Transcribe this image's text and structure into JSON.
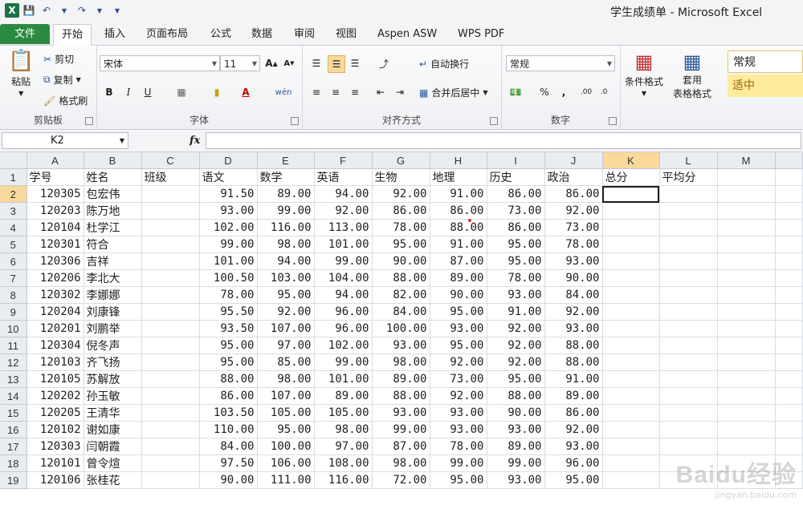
{
  "window": {
    "title": "学生成绩单 - Microsoft Excel",
    "app_icon": "X"
  },
  "quick_access": {
    "save_icon": "save-icon",
    "undo_icon": "undo-icon",
    "redo_icon": "redo-icon"
  },
  "tabs": [
    "文件",
    "开始",
    "插入",
    "页面布局",
    "公式",
    "数据",
    "审阅",
    "视图",
    "Aspen ASW",
    "WPS PDF"
  ],
  "ribbon": {
    "clipboard": {
      "paste": "粘贴",
      "cut": "剪切",
      "copy": "复制",
      "format_painter": "格式刷",
      "label": "剪贴板"
    },
    "font": {
      "name": "宋体",
      "size": "11",
      "label": "字体",
      "bold": "B",
      "italic": "I",
      "underline": "U",
      "wen": "wén"
    },
    "alignment": {
      "wrap": "自动换行",
      "merge": "合并后居中",
      "label": "对齐方式"
    },
    "number": {
      "format": "常规",
      "percent": "%",
      "comma": ",",
      "label": "数字"
    },
    "styles": {
      "conditional": "条件格式",
      "table_format_1": "套用",
      "table_format_2": "表格格式",
      "style_normal": "常规",
      "style_neutral": "适中"
    }
  },
  "formula_bar": {
    "name_box": "K2",
    "fx": "fx",
    "value": ""
  },
  "columns": [
    "A",
    "B",
    "C",
    "D",
    "E",
    "F",
    "G",
    "H",
    "I",
    "J",
    "K",
    "L",
    "M"
  ],
  "header_row": [
    "学号",
    "姓名",
    "班级",
    "语文",
    "数学",
    "英语",
    "生物",
    "地理",
    "历史",
    "政治",
    "总分",
    "平均分",
    ""
  ],
  "rows": [
    [
      "120305",
      "包宏伟",
      "",
      "91.50",
      "89.00",
      "94.00",
      "92.00",
      "91.00",
      "86.00",
      "86.00"
    ],
    [
      "120203",
      "陈万地",
      "",
      "93.00",
      "99.00",
      "92.00",
      "86.00",
      "86.00",
      "73.00",
      "92.00"
    ],
    [
      "120104",
      "杜学江",
      "",
      "102.00",
      "116.00",
      "113.00",
      "78.00",
      "88.00",
      "86.00",
      "73.00"
    ],
    [
      "120301",
      "符合",
      "",
      "99.00",
      "98.00",
      "101.00",
      "95.00",
      "91.00",
      "95.00",
      "78.00"
    ],
    [
      "120306",
      "吉祥",
      "",
      "101.00",
      "94.00",
      "99.00",
      "90.00",
      "87.00",
      "95.00",
      "93.00"
    ],
    [
      "120206",
      "李北大",
      "",
      "100.50",
      "103.00",
      "104.00",
      "88.00",
      "89.00",
      "78.00",
      "90.00"
    ],
    [
      "120302",
      "李娜娜",
      "",
      "78.00",
      "95.00",
      "94.00",
      "82.00",
      "90.00",
      "93.00",
      "84.00"
    ],
    [
      "120204",
      "刘康锋",
      "",
      "95.50",
      "92.00",
      "96.00",
      "84.00",
      "95.00",
      "91.00",
      "92.00"
    ],
    [
      "120201",
      "刘鹏举",
      "",
      "93.50",
      "107.00",
      "96.00",
      "100.00",
      "93.00",
      "92.00",
      "93.00"
    ],
    [
      "120304",
      "倪冬声",
      "",
      "95.00",
      "97.00",
      "102.00",
      "93.00",
      "95.00",
      "92.00",
      "88.00"
    ],
    [
      "120103",
      "齐飞扬",
      "",
      "95.00",
      "85.00",
      "99.00",
      "98.00",
      "92.00",
      "92.00",
      "88.00"
    ],
    [
      "120105",
      "苏解放",
      "",
      "88.00",
      "98.00",
      "101.00",
      "89.00",
      "73.00",
      "95.00",
      "91.00"
    ],
    [
      "120202",
      "孙玉敏",
      "",
      "86.00",
      "107.00",
      "89.00",
      "88.00",
      "92.00",
      "88.00",
      "89.00"
    ],
    [
      "120205",
      "王清华",
      "",
      "103.50",
      "105.00",
      "105.00",
      "93.00",
      "93.00",
      "90.00",
      "86.00"
    ],
    [
      "120102",
      "谢如康",
      "",
      "110.00",
      "95.00",
      "98.00",
      "99.00",
      "93.00",
      "93.00",
      "92.00"
    ],
    [
      "120303",
      "闫朝霞",
      "",
      "84.00",
      "100.00",
      "97.00",
      "87.00",
      "78.00",
      "89.00",
      "93.00"
    ],
    [
      "120101",
      "曾令煊",
      "",
      "97.50",
      "106.00",
      "108.00",
      "98.00",
      "99.00",
      "99.00",
      "96.00"
    ],
    [
      "120106",
      "张桂花",
      "",
      "90.00",
      "111.00",
      "116.00",
      "72.00",
      "95.00",
      "93.00",
      "95.00"
    ]
  ],
  "watermark": {
    "main": "Baidu经验",
    "sub": "jingyan.baidu.com"
  },
  "colors": {
    "file_tab": "#2a8a3e",
    "selected_header": "#f9d99b",
    "neutral_style": "#ffeb9c"
  }
}
